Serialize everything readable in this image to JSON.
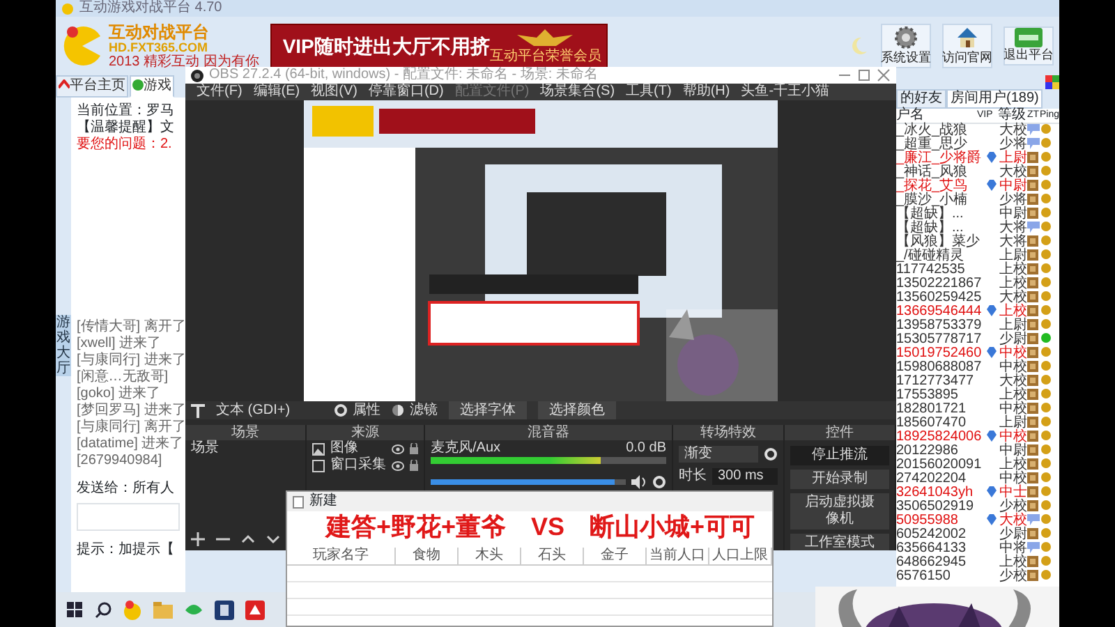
{
  "app_window": {
    "title": "互动游戏对战平台 4.70",
    "logo_text": "互动对战平台",
    "logo_url": "HD.FXT365.COM",
    "logo_slogan": "2013 精彩互动 因为有你",
    "banner_text": "VIP随时进出大厅不用挤",
    "banner_badge": "互动平台荣誉会员"
  },
  "header_buttons": [
    {
      "label": "系统设置",
      "kind": "gear"
    },
    {
      "label": "访问官网",
      "kind": "house"
    },
    {
      "label": "退出平台",
      "kind": "exit"
    }
  ],
  "side_tab": "游戏大厅",
  "tabs": [
    {
      "label": "平台主页",
      "selected": false
    },
    {
      "label": "游戏",
      "selected": true
    }
  ],
  "location": "当前位置：罗马",
  "notice": "【温馨提醒】文",
  "warning": "要您的问题：2.",
  "chat_log": [
    "[传情大哥] 离开了",
    "[xwell] 进来了",
    "[与康同行] 进来了",
    "[闲意…无敌哥]",
    "[goko] 进来了",
    "[梦回罗马] 进来了",
    "[与康同行] 离开了",
    "[datatime] 进来了",
    "[2679940984]"
  ],
  "send_to": {
    "label": "发送给：",
    "value": "所有人"
  },
  "hint": "提示：加提示【",
  "user_tabs": [
    {
      "label": "的好友",
      "selected": false
    },
    {
      "label": "房间用户(189)",
      "selected": true
    }
  ],
  "user_columns": [
    "户名",
    "VIP",
    "等级",
    "ZT",
    "Ping"
  ],
  "users": [
    {
      "name": "_冰火_战狼",
      "vip": false,
      "level": "大校",
      "kind": "chat",
      "color": "#d4a017"
    },
    {
      "name": "_超重_思少",
      "vip": false,
      "level": "少将",
      "kind": "chat",
      "color": "#d4a017"
    },
    {
      "name": "_廉江_少将爵",
      "vip": true,
      "level": "上尉",
      "kind": "box",
      "color": "#d4a017"
    },
    {
      "name": "_神话_风狼",
      "vip": false,
      "level": "大校",
      "kind": "box",
      "color": "#d4a017"
    },
    {
      "name": "_探花_艾鸟",
      "vip": true,
      "level": "中尉",
      "kind": "box",
      "color": "#d4a017"
    },
    {
      "name": "_膜沙_小楠",
      "vip": false,
      "level": "少将",
      "kind": "box",
      "color": "#d4a017"
    },
    {
      "name": "【超缺】...",
      "vip": false,
      "level": "中尉",
      "kind": "box",
      "color": "#d4a017"
    },
    {
      "name": "【超缺】...",
      "vip": false,
      "level": "大将",
      "kind": "chat",
      "color": "#d4a017"
    },
    {
      "name": "【风狼】菜少",
      "vip": false,
      "level": "大将",
      "kind": "box",
      "color": "#d4a017"
    },
    {
      "name": "_/碰碰精灵",
      "vip": false,
      "level": "上尉",
      "kind": "box",
      "color": "#d4a017"
    },
    {
      "name": "117742535",
      "vip": false,
      "level": "上校",
      "kind": "box",
      "color": "#d4a017"
    },
    {
      "name": "13502221867",
      "vip": false,
      "level": "上校",
      "kind": "box",
      "color": "#d4a017"
    },
    {
      "name": "13560259425",
      "vip": false,
      "level": "大校",
      "kind": "box",
      "color": "#d4a017"
    },
    {
      "name": "13669546444",
      "vip": true,
      "level": "上校",
      "kind": "box",
      "color": "#d4a017"
    },
    {
      "name": "13958753379",
      "vip": false,
      "level": "上尉",
      "kind": "box",
      "color": "#d4a017"
    },
    {
      "name": "15305778717",
      "vip": false,
      "level": "少尉",
      "kind": "box",
      "color": "#22bb22"
    },
    {
      "name": "15019752460",
      "vip": true,
      "level": "中校",
      "kind": "box",
      "color": "#d4a017"
    },
    {
      "name": "15980688087",
      "vip": false,
      "level": "中校",
      "kind": "box",
      "color": "#d4a017"
    },
    {
      "name": "1712773477",
      "vip": false,
      "level": "大校",
      "kind": "box",
      "color": "#d4a017"
    },
    {
      "name": "17553895",
      "vip": false,
      "level": "上校",
      "kind": "box",
      "color": "#d4a017"
    },
    {
      "name": "182801721",
      "vip": false,
      "level": "中校",
      "kind": "box",
      "color": "#d4a017"
    },
    {
      "name": "185607470",
      "vip": false,
      "level": "上尉",
      "kind": "box",
      "color": "#d4a017"
    },
    {
      "name": "18925824006",
      "vip": true,
      "level": "中校",
      "kind": "box",
      "color": "#d4a017"
    },
    {
      "name": "20122986",
      "vip": false,
      "level": "中尉",
      "kind": "box",
      "color": "#d4a017"
    },
    {
      "name": "20156020091",
      "vip": false,
      "level": "上校",
      "kind": "box",
      "color": "#d4a017"
    },
    {
      "name": "274202204",
      "vip": false,
      "level": "中校",
      "kind": "box",
      "color": "#d4a017"
    },
    {
      "name": "32641043yh",
      "vip": true,
      "level": "中士",
      "kind": "box",
      "color": "#d4a017"
    },
    {
      "name": "3506502919",
      "vip": false,
      "level": "少校",
      "kind": "box",
      "color": "#d4a017"
    },
    {
      "name": "50955988",
      "vip": true,
      "level": "大校",
      "kind": "chat",
      "color": "#d4a017"
    },
    {
      "name": "605242002",
      "vip": false,
      "level": "少尉",
      "kind": "box",
      "color": "#d4a017"
    },
    {
      "name": "635664133",
      "vip": false,
      "level": "中将",
      "kind": "chat",
      "color": "#d4a017"
    },
    {
      "name": "648662945",
      "vip": false,
      "level": "上校",
      "kind": "box",
      "color": "#d4a017"
    },
    {
      "name": "6576150",
      "vip": false,
      "level": "少校",
      "kind": "box",
      "color": "#d4a017"
    }
  ],
  "obs": {
    "title": "OBS 27.2.4 (64-bit, windows) - 配置文件: 未命名 - 场景: 未命名",
    "menu": [
      {
        "label": "文件(F)",
        "disabled": false
      },
      {
        "label": "编辑(E)",
        "disabled": false
      },
      {
        "label": "视图(V)",
        "disabled": false
      },
      {
        "label": "停靠窗口(D)",
        "disabled": false
      },
      {
        "label": "配置文件(P)",
        "disabled": true
      },
      {
        "label": "场景集合(S)",
        "disabled": false
      },
      {
        "label": "工具(T)",
        "disabled": false
      },
      {
        "label": "帮助(H)",
        "disabled": false
      },
      {
        "label": "头鱼-千王小猫",
        "disabled": false
      }
    ],
    "source_label": "文本 (GDI+)",
    "properties": "属性",
    "filters": "滤镜",
    "font_button": "选择字体",
    "color_button": "选择颜色",
    "docks": [
      "场景",
      "来源",
      "混音器",
      "转场特效",
      "控件"
    ],
    "scenes": [
      "场景"
    ],
    "sources": [
      "图像",
      "窗口采集"
    ],
    "mixer": {
      "channel": "麦克风/Aux",
      "reading": "0.0 dB",
      "meter": {
        "level": 0.72
      },
      "volume": {
        "level": 0.94
      }
    },
    "transition": {
      "value": "渐变",
      "duration_label": "时长",
      "duration": "300 ms"
    },
    "controls": [
      "停止推流",
      "开始录制",
      "启动虚拟摄像机",
      "工作室模式"
    ]
  },
  "overlay_text": "建答+野花+董爷　VS　断山小城+可可",
  "table_window": {
    "title": "新建",
    "columns": [
      "玩家名字",
      "食物",
      "木头",
      "石头",
      "金子",
      "当前人口",
      "人口上限"
    ]
  }
}
